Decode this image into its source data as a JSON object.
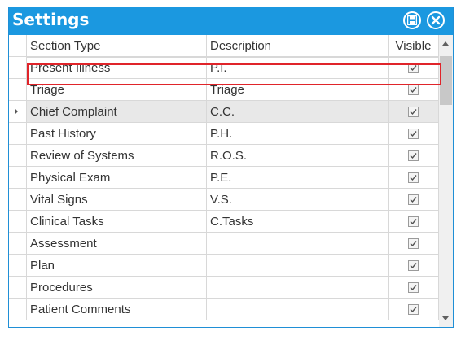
{
  "window": {
    "title": "Settings"
  },
  "grid": {
    "columns": [
      "Section Type",
      "Description",
      "Visible"
    ],
    "rows": [
      {
        "section": "Present Illness",
        "description": "P.I.",
        "visible": true
      },
      {
        "section": "Triage",
        "description": "Triage",
        "visible": true
      },
      {
        "section": "Chief Complaint",
        "description": "C.C.",
        "visible": true
      },
      {
        "section": "Past History",
        "description": "P.H.",
        "visible": true
      },
      {
        "section": "Review of Systems",
        "description": "R.O.S.",
        "visible": true
      },
      {
        "section": "Physical Exam",
        "description": "P.E.",
        "visible": true
      },
      {
        "section": "Vital Signs",
        "description": "V.S.",
        "visible": true
      },
      {
        "section": "Clinical Tasks",
        "description": "C.Tasks",
        "visible": true
      },
      {
        "section": "Assessment",
        "description": "",
        "visible": true
      },
      {
        "section": "Plan",
        "description": "",
        "visible": true
      },
      {
        "section": "Procedures",
        "description": "",
        "visible": true
      },
      {
        "section": "Patient Comments",
        "description": "",
        "visible": true
      }
    ]
  },
  "colors": {
    "titlebar": "#1b98e0",
    "selection_outline": "#e0242a"
  },
  "icons": {
    "save": "save-icon",
    "close": "close-icon"
  }
}
